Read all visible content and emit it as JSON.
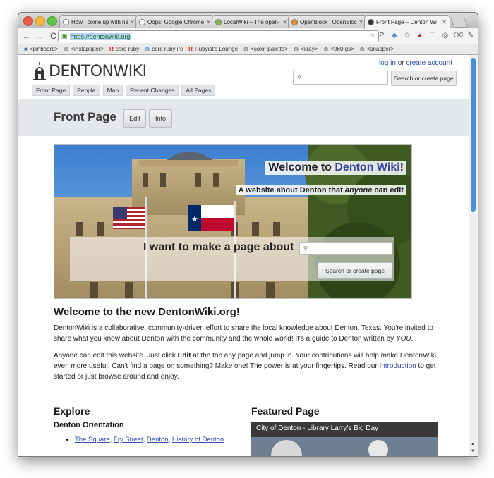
{
  "browser": {
    "tabs": [
      {
        "label": "How I come up with ne"
      },
      {
        "label": "Oops! Google Chrome c"
      },
      {
        "label": "LocalWiki – The open-"
      },
      {
        "label": "OpenBlock | OpenBlock"
      },
      {
        "label": "Front Page – Denton Wi"
      }
    ],
    "url": "https://dentonwiki.org",
    "bookmarks": [
      {
        "label": "<pinboard>",
        "icon": "folder-icon"
      },
      {
        "label": "<instapaper>",
        "icon": "globe-icon"
      },
      {
        "label": "core ruby",
        "icon": "R"
      },
      {
        "label": "core ruby irc",
        "icon": "globe-icon"
      },
      {
        "label": "Rubyist's Lounge",
        "icon": "R"
      },
      {
        "label": "<color palette>",
        "icon": "globe-icon"
      },
      {
        "label": "<xray>",
        "icon": "globe-icon"
      },
      {
        "label": "<960.gs>",
        "icon": "globe-icon"
      },
      {
        "label": "<snapper>",
        "icon": "globe-icon"
      }
    ]
  },
  "site": {
    "logo_main": "DENTON",
    "logo_wiki": "WIKI",
    "login": "log in",
    "or": "or",
    "create_account": "create account",
    "nav": [
      "Front Page",
      "People",
      "Map",
      "Recent Changes",
      "All Pages"
    ],
    "search_button": "Search or create page"
  },
  "page": {
    "title": "Front Page",
    "edit": "Edit",
    "info": "Info"
  },
  "hero": {
    "welcome_prefix": "Welcome to ",
    "welcome_accent": "Denton Wiki",
    "welcome_suffix": "!",
    "sub_prefix": "A website about Denton that ",
    "sub_em": "anyone",
    "sub_suffix": " can edit",
    "prompt": "I want to make a page about",
    "button": "Search or create page"
  },
  "content": {
    "heading": "Welcome to the new DentonWiki.org!",
    "p1_a": "DentonWiki is a collaborative, community-driven effort to share the local knowledge about Denton, Texas. You're invited to share what you know about Denton with the community and the whole world! It's a guide to Denton written by ",
    "p1_em": "YOU",
    "p1_b": ".",
    "p2_a": "Anyone can edit this website. Just click ",
    "p2_bold": "Edit",
    "p2_b": " at the top any page and jump in. Your contributions will help make DentonWiki even more useful. Can't find a page on something? Make one! The power is at your fingertips. Read our ",
    "p2_link": "Introduction",
    "p2_c": " to get started or just browse around and enjoy."
  },
  "explore": {
    "title": "Explore",
    "subtitle": "Denton Orientation",
    "links": [
      "The Square",
      "Fry Street",
      "Denton",
      "History of Denton"
    ]
  },
  "featured": {
    "title": "Featured Page",
    "caption": "City of Denton - Library Larry's Big Day"
  }
}
